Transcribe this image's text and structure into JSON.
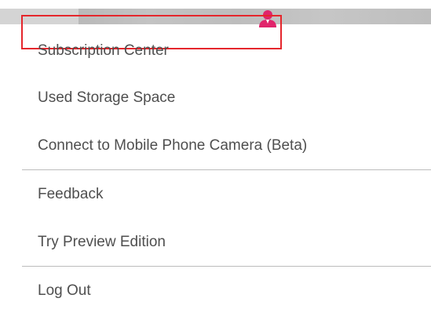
{
  "header": {
    "avatar_icon": "user-icon",
    "avatar_color": "#e0246b"
  },
  "menu": {
    "items": [
      {
        "label": "Subscription Center",
        "selected": true
      },
      {
        "label": "Used Storage Space"
      },
      {
        "label": "Connect to Mobile Phone Camera (Beta)"
      },
      {
        "label": "Feedback"
      },
      {
        "label": "Try Preview Edition"
      },
      {
        "label": "Log Out"
      }
    ],
    "highlight_color": "#e5262c"
  }
}
